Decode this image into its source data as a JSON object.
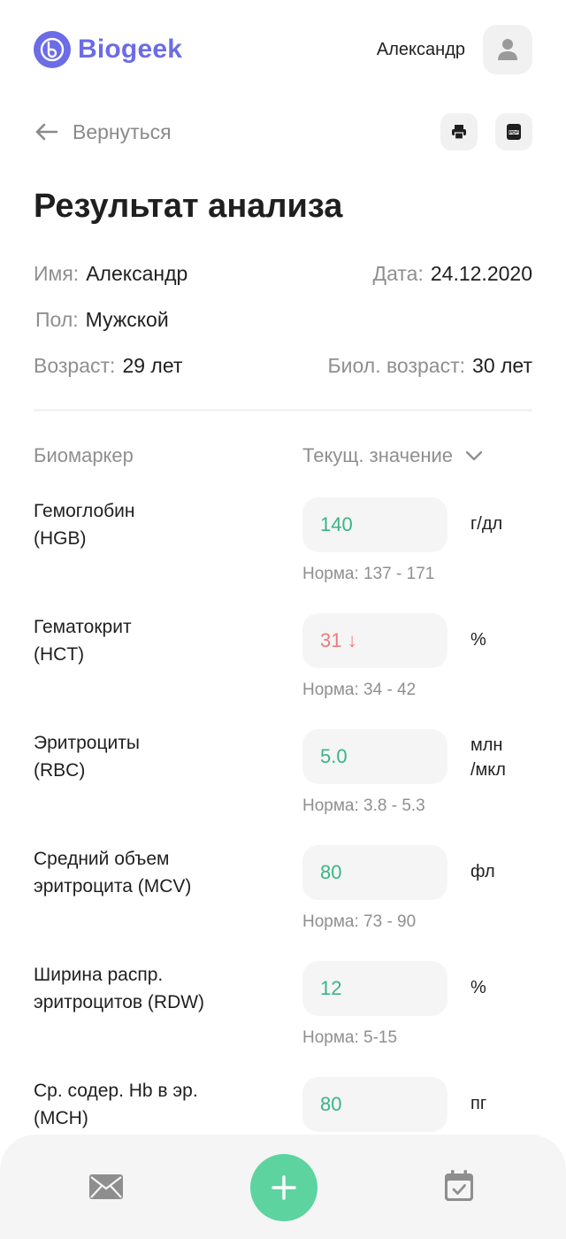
{
  "header": {
    "logo_text": "Biogeek",
    "user_name": "Александр"
  },
  "nav": {
    "back_label": "Вернуться"
  },
  "page_title": "Результат анализа",
  "info": {
    "name_label": "Имя:",
    "name_value": "Александр",
    "date_label": "Дата:",
    "date_value": "24.12.2020",
    "sex_label": "Пол:",
    "sex_value": "Мужской",
    "age_label": "Возраст:",
    "age_value": "29 лет",
    "bio_age_label": "Биол. возраст:",
    "bio_age_value": "30 лет"
  },
  "table": {
    "col_biomarker": "Биомаркер",
    "col_current": "Текущ. значение",
    "rows": [
      {
        "name": "Гемоглобин\n(HGB)",
        "value": "140",
        "status": "ok",
        "unit": "г/дл",
        "norm": "Норма: 137 - 171"
      },
      {
        "name": "Гематокрит\n(HCT)",
        "value": "31 ↓",
        "status": "low",
        "unit": "%",
        "norm": "Норма: 34 - 42"
      },
      {
        "name": "Эритроциты\n(RBC)",
        "value": "5.0",
        "status": "ok",
        "unit": "млн\n/мкл",
        "norm": "Норма: 3.8 - 5.3"
      },
      {
        "name": "Средний объем\nэритроцита (MCV)",
        "value": "80",
        "status": "ok",
        "unit": "фл",
        "norm": "Норма: 73 - 90"
      },
      {
        "name": "Ширина распр.\nэритроцитов (RDW)",
        "value": "12",
        "status": "ok",
        "unit": "%",
        "norm": "Норма: 5-15"
      },
      {
        "name": "Ср. содер. Hb в эр.\n(MCH)",
        "value": "80",
        "status": "ok",
        "unit": "пг",
        "norm": ""
      }
    ]
  },
  "colors": {
    "brand": "#6b6ce6",
    "ok": "#39b487",
    "low": "#ef7a7a",
    "accent": "#5dd3a0"
  },
  "icons": {
    "logo": "biogeek-logo-icon",
    "avatar": "user-icon",
    "back": "arrow-left-icon",
    "print": "printer-icon",
    "pdf": "pdf-icon",
    "dropdown": "chevron-down-icon",
    "mail": "mail-icon",
    "add": "plus-icon",
    "calendar": "calendar-check-icon"
  }
}
